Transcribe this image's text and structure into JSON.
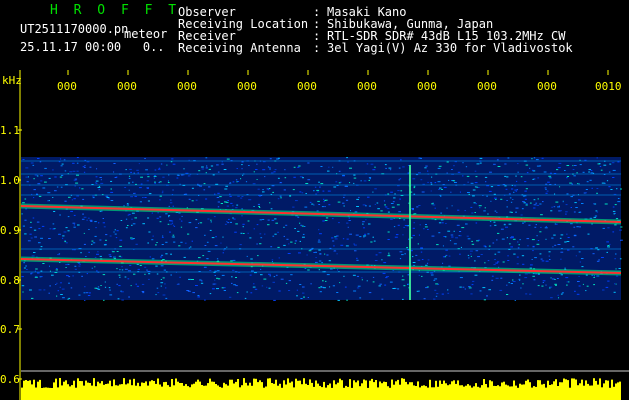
{
  "header": {
    "logo": "H R O F F T",
    "filename": "UT2511170000.pn",
    "meteor_label": "meteor",
    "date": "25.11.17",
    "time": "00:00",
    "count": "0..",
    "fields": [
      {
        "label": "Observer",
        "value": "Masaki Kano"
      },
      {
        "label": "Receiving Location",
        "value": "Shibukawa, Gunma, Japan"
      },
      {
        "label": "Receiver",
        "value": "RTL-SDR SDR# 43dB L15 103.2MHz CW"
      },
      {
        "label": "Receiving Antenna",
        "value": "3el Yagi(V) Az 330 for Vladivostok"
      }
    ]
  },
  "axis": {
    "unit": "kHz",
    "y_ticks": [
      "1.1",
      "1.0",
      "0.9",
      "0.8",
      "0.7",
      "0.6"
    ],
    "x_ticks": [
      "000",
      "000",
      "000",
      "000",
      "000",
      "000",
      "000",
      "000",
      "000",
      "0010"
    ]
  },
  "colors": {
    "axis_text": "#ffff00",
    "logo": "#00e000",
    "signal": "#ff3030",
    "noise": "#0030ff",
    "amplitude": "#ffff00"
  }
}
